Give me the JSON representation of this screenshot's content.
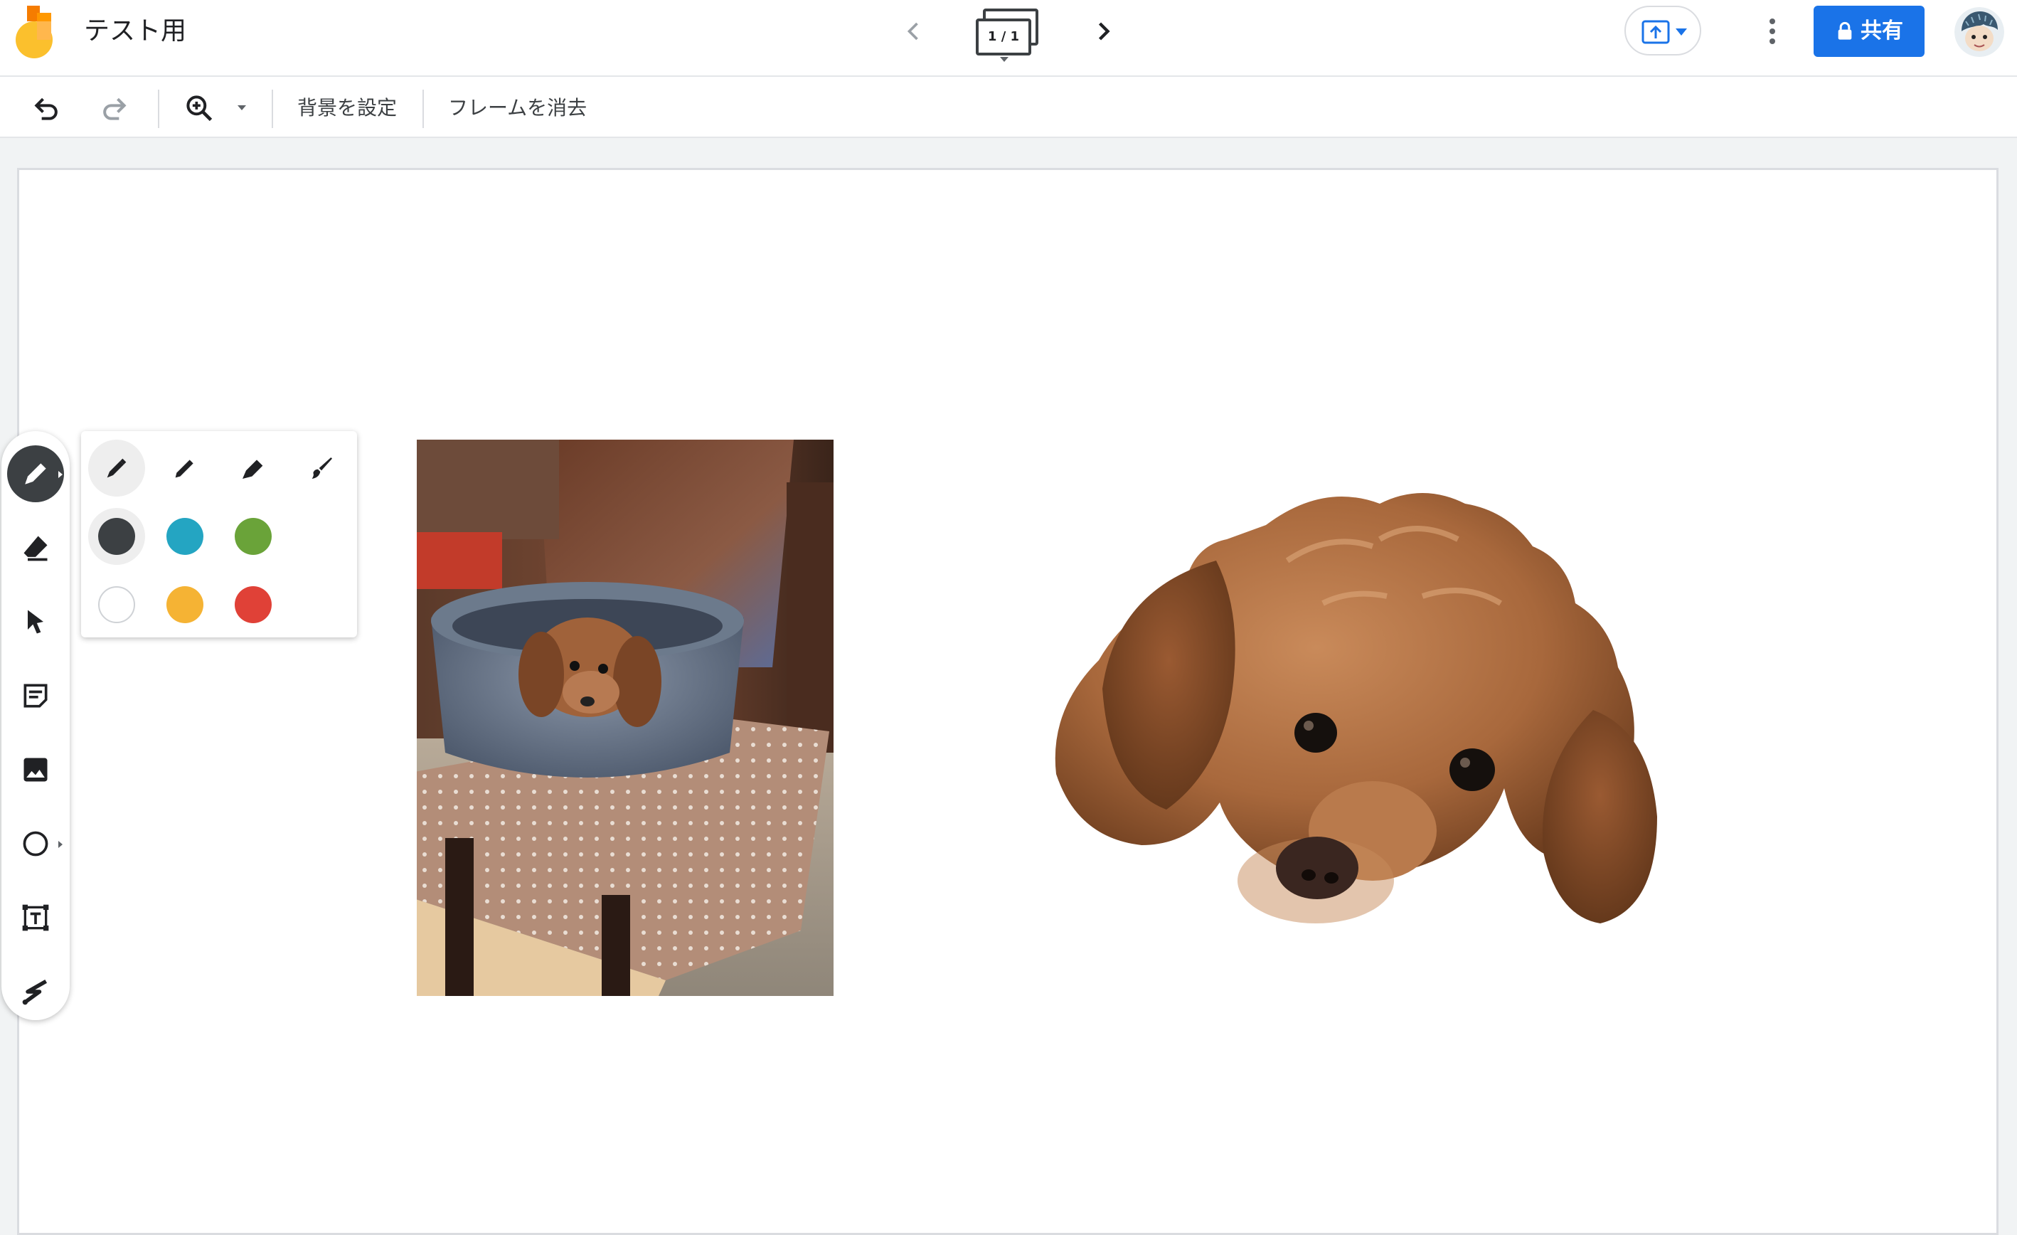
{
  "header": {
    "title": "テスト用",
    "frame_indicator": "1 / 1",
    "share_label": "共有"
  },
  "toolbar": {
    "set_background": "背景を設定",
    "clear_frame": "フレームを消去"
  },
  "palette": {
    "pens": [
      "marker",
      "pen",
      "highlighter",
      "brush"
    ],
    "selected_pen": "marker",
    "colors": [
      "#3c4043",
      "#24a5c2",
      "#6aa339",
      "#ffffff",
      "#f5b334",
      "#e04137"
    ],
    "selected_color": "#3c4043"
  },
  "rail": {
    "tools": [
      "pen",
      "eraser",
      "select",
      "sticky-note",
      "image",
      "circle",
      "text-box",
      "laser"
    ],
    "active_tool": "pen"
  },
  "colors": {
    "accent": "#1a73e8",
    "icon": "#3c4043"
  }
}
